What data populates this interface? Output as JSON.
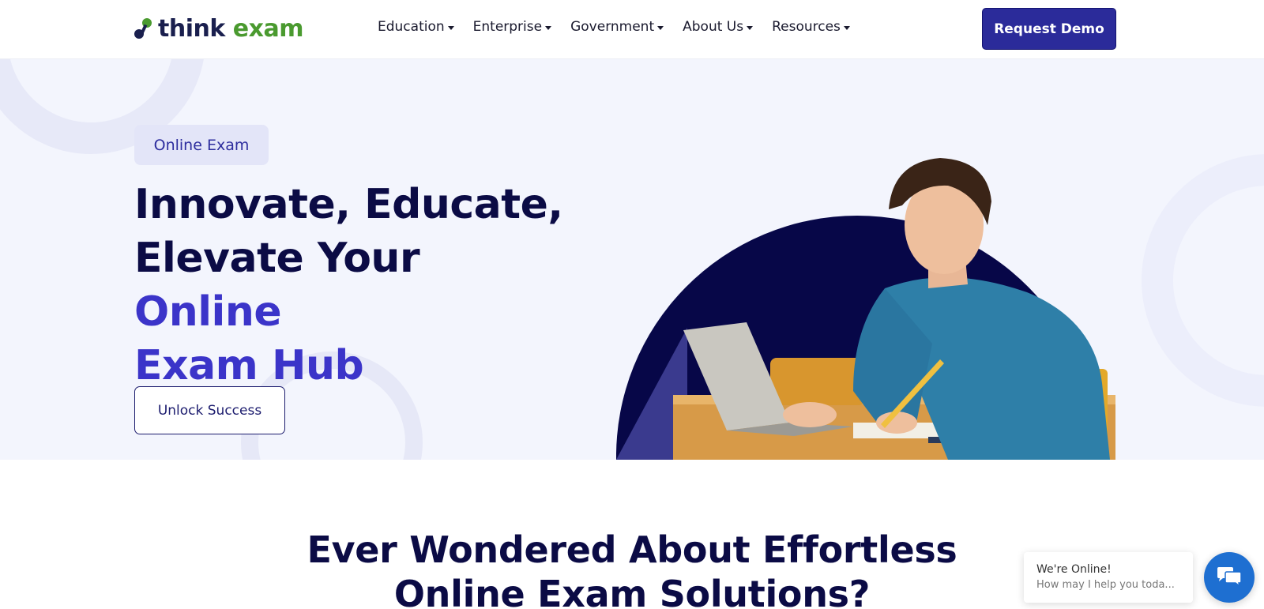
{
  "header": {
    "logo": {
      "part1": "think",
      "part2": "exam"
    },
    "nav": [
      {
        "label": "Education"
      },
      {
        "label": "Enterprise"
      },
      {
        "label": "Government"
      },
      {
        "label": "About Us"
      },
      {
        "label": "Resources"
      }
    ],
    "cta_label": "Request Demo"
  },
  "hero": {
    "badge": "Online Exam",
    "headline": {
      "line1": "Innovate, Educate,",
      "line2_plain": "Elevate Your ",
      "line2_accent": "Online",
      "line3_accent": "Exam Hub"
    },
    "cta_label": "Unlock Success"
  },
  "section": {
    "title_line1": "Ever Wondered About Effortless",
    "title_line2": "Online Exam Solutions?"
  },
  "chat": {
    "title": "We're Online!",
    "subtitle": "How may I help you toda..."
  },
  "colors": {
    "primary": "#2b2b9a",
    "accent": "#3b34c9",
    "dark": "#0b0b45",
    "logo_green": "#4a9a2f",
    "hero_bg": "#f3f5fd",
    "chat_blue": "#1e6fd1"
  },
  "icons": {
    "logo": "think-exam-logo-icon",
    "caret": "chevron-down-icon",
    "chat": "chat-bubbles-icon"
  }
}
